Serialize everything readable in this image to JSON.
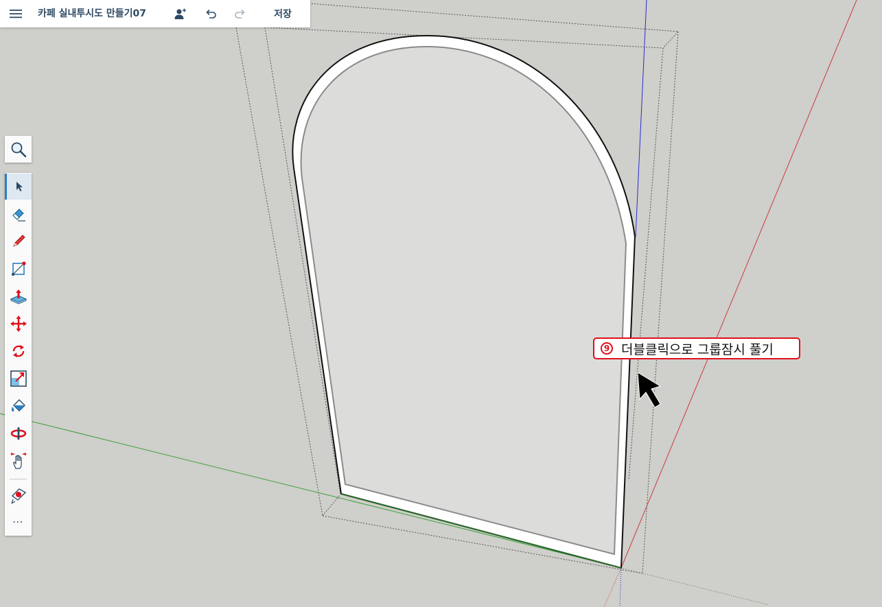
{
  "header": {
    "title": "카페 실내투시도 만들기07",
    "save_label": "저장"
  },
  "icons": {
    "menu": "hamburger-menu-icon",
    "share": "add-person-icon",
    "undo": "undo-icon",
    "redo": "redo-icon"
  },
  "toolbar": {
    "search": "search-icon",
    "tools": [
      "select",
      "eraser",
      "pencil",
      "shape",
      "push-pull",
      "move",
      "rotate",
      "scale",
      "paint-bucket",
      "orbit",
      "pan",
      "tape-measure"
    ],
    "more_label": "⋯"
  },
  "annotation": {
    "number": "9",
    "text": "더블클릭으로 그룹잠시 풀기"
  },
  "colors": {
    "background": "#cfcfcb",
    "axis_red": "#c83c3c",
    "axis_green": "#3aa23a",
    "axis_blue": "#2a2ad0",
    "callout_border": "#e0101a",
    "header_text": "#2d4a63"
  }
}
